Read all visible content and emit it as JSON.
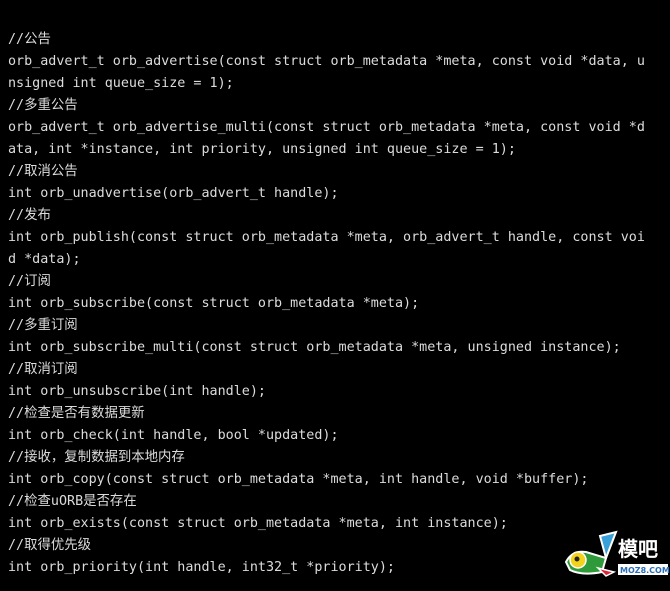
{
  "code_lines": [
    "//公告",
    "orb_advert_t orb_advertise(const struct orb_metadata *meta, const void *data, u",
    "nsigned int queue_size = 1);",
    "//多重公告",
    "orb_advert_t orb_advertise_multi(const struct orb_metadata *meta, const void *d",
    "ata, int *instance, int priority, unsigned int queue_size = 1);",
    "//取消公告",
    "int orb_unadvertise(orb_advert_t handle);",
    "//发布",
    "int orb_publish(const struct orb_metadata *meta, orb_advert_t handle, const voi",
    "d *data);",
    "//订阅",
    "int orb_subscribe(const struct orb_metadata *meta);",
    "//多重订阅",
    "int orb_subscribe_multi(const struct orb_metadata *meta, unsigned instance);",
    "//取消订阅",
    "int orb_unsubscribe(int handle);",
    "//检查是否有数据更新",
    "int orb_check(int handle, bool *updated);",
    "//接收，复制数据到本地内存",
    "int orb_copy(const struct orb_metadata *meta, int handle, void *buffer);",
    "//检查uORB是否存在",
    "int orb_exists(const struct orb_metadata *meta, int instance);",
    "//取得优先级",
    "int orb_priority(int handle, int32_t *priority);"
  ],
  "watermark": {
    "name": "模吧",
    "site": "MOZ8.COM"
  },
  "colors": {
    "background": "#000000",
    "text": "#dcdcdc"
  }
}
